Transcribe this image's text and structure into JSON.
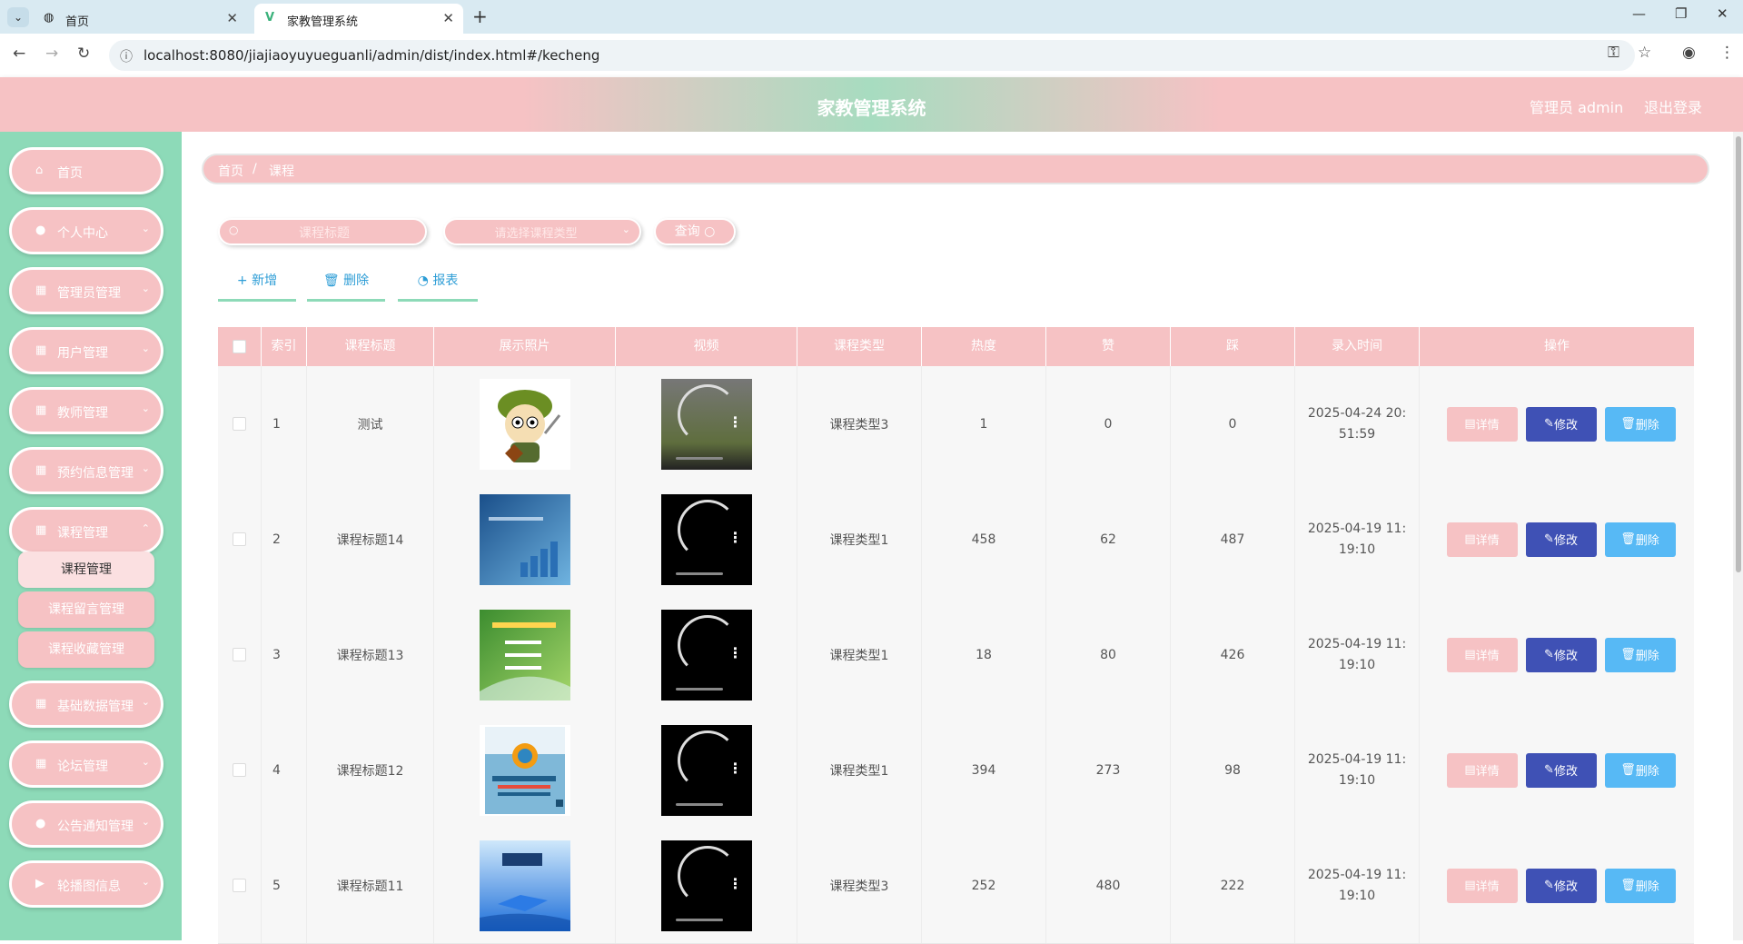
{
  "browser": {
    "tabs": [
      {
        "label": "首页",
        "icon": "globe-icon"
      },
      {
        "label": "家教管理系统",
        "icon": "vue-icon"
      }
    ],
    "url": "localhost:8080/jiajiaoyuyueguanli/admin/dist/index.html#/kecheng"
  },
  "header": {
    "title": "家教管理系统",
    "admin": "管理员 admin",
    "logout": "退出登录"
  },
  "sidebar": {
    "items": [
      {
        "label": "首页",
        "icon": "home-icon"
      },
      {
        "label": "个人中心",
        "icon": "user-icon"
      },
      {
        "label": "管理员管理",
        "icon": "grid-icon"
      },
      {
        "label": "用户管理",
        "icon": "grid-icon"
      },
      {
        "label": "教师管理",
        "icon": "grid-icon"
      },
      {
        "label": "预约信息管理",
        "icon": "grid-icon"
      },
      {
        "label": "课程管理",
        "icon": "grid-icon"
      },
      {
        "label": "基础数据管理",
        "icon": "grid-icon"
      },
      {
        "label": "论坛管理",
        "icon": "grid-icon"
      },
      {
        "label": "公告通知管理",
        "icon": "user-icon"
      },
      {
        "label": "轮播图信息",
        "icon": "video-icon"
      }
    ],
    "submenu": [
      "课程管理",
      "课程留言管理",
      "课程收藏管理"
    ]
  },
  "breadcrumb": {
    "home": "首页",
    "sep": "/",
    "current": "课程"
  },
  "search": {
    "title_placeholder": "课程标题",
    "type_placeholder": "请选择课程类型",
    "query_label": "查询"
  },
  "actions": {
    "add": "新增",
    "delete": "删除",
    "report": "报表"
  },
  "table": {
    "headers": [
      "索引",
      "课程标题",
      "展示照片",
      "视频",
      "课程类型",
      "热度",
      "赞",
      "踩",
      "录入时间",
      "操作"
    ],
    "ops": {
      "detail": "详情",
      "edit": "修改",
      "delete": "删除"
    },
    "rows": [
      {
        "index": "1",
        "title": "测试",
        "type": "课程类型3",
        "hot": "1",
        "like": "0",
        "dislike": "0",
        "time": "2025-04-24 20:51:59",
        "photo": "mascot"
      },
      {
        "index": "2",
        "title": "课程标题14",
        "type": "课程类型1",
        "hot": "458",
        "like": "62",
        "dislike": "487",
        "time": "2025-04-19 11:19:10",
        "photo": "blue-book"
      },
      {
        "index": "3",
        "title": "课程标题13",
        "type": "课程类型1",
        "hot": "18",
        "like": "80",
        "dislike": "426",
        "time": "2025-04-19 11:19:10",
        "photo": "green-book"
      },
      {
        "index": "4",
        "title": "课程标题12",
        "type": "课程类型1",
        "hot": "394",
        "like": "273",
        "dislike": "98",
        "time": "2025-04-19 11:19:10",
        "photo": "java-book"
      },
      {
        "index": "5",
        "title": "课程标题11",
        "type": "课程类型3",
        "hot": "252",
        "like": "480",
        "dislike": "222",
        "time": "2025-04-19 11:19:10",
        "photo": "physics-book"
      }
    ]
  },
  "colors": {
    "pink": "#f6c2c4",
    "green": "#8ddab8",
    "edit": "#3f51b5",
    "del": "#57b9f5"
  }
}
